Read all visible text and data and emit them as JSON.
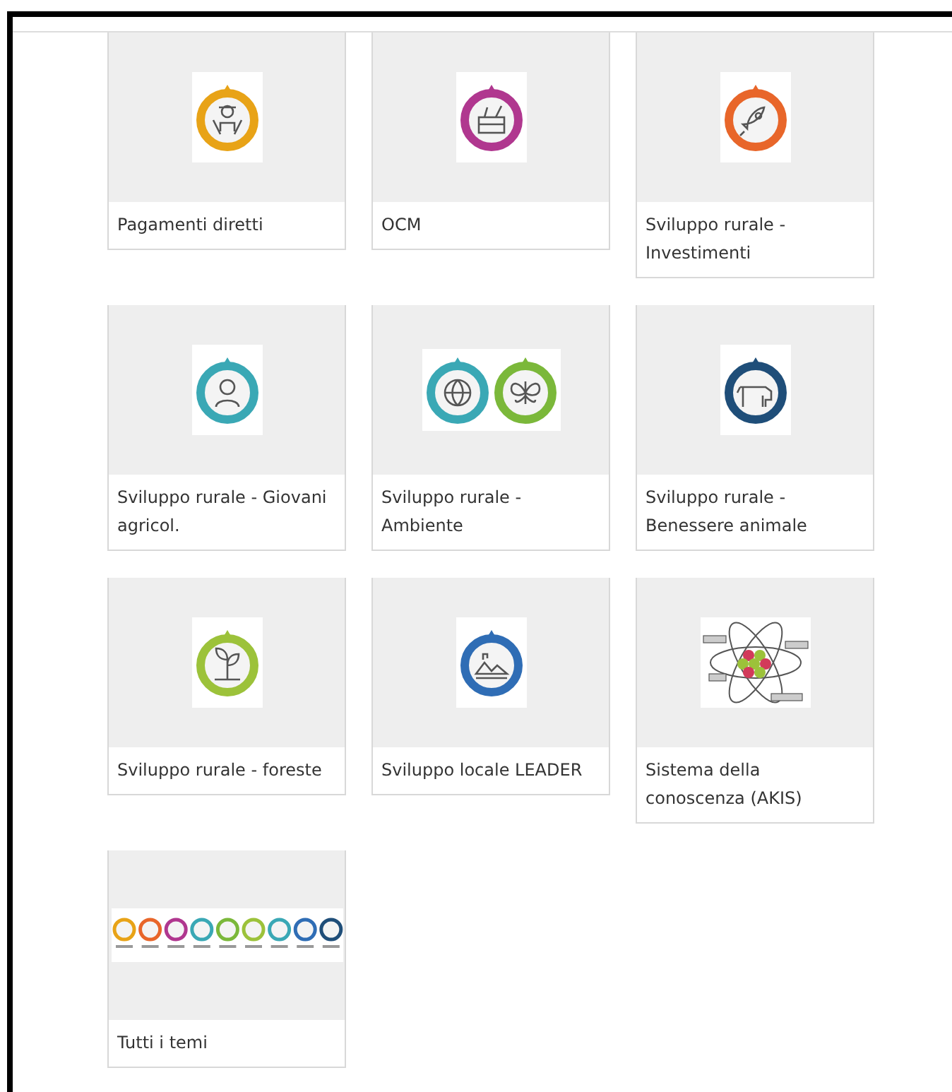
{
  "cards": [
    {
      "label": "Pagamenti diretti",
      "kind": "farmer",
      "color": "#e8a317"
    },
    {
      "label": "OCM",
      "kind": "crate",
      "color": "#b0378f"
    },
    {
      "label": "Sviluppo rurale - Investimenti",
      "kind": "rocket",
      "color": "#e8662a"
    },
    {
      "label": "Sviluppo rurale - Giovani agricol.",
      "kind": "person",
      "color": "#3aa8b5"
    },
    {
      "label": "Sviluppo rurale - Ambiente",
      "kind": "pair",
      "color": "#3aa8b5"
    },
    {
      "label": "Sviluppo rurale - Benessere animale",
      "kind": "cow",
      "color": "#1f4e79"
    },
    {
      "label": "Sviluppo rurale - foreste",
      "kind": "plant",
      "color": "#9cc23a"
    },
    {
      "label": "Sviluppo locale LEADER",
      "kind": "landscape",
      "color": "#2f6db5"
    },
    {
      "label": "Sistema della conoscenza (AKIS)",
      "kind": "atom"
    },
    {
      "label": "Tutti i temi",
      "kind": "strip"
    }
  ]
}
